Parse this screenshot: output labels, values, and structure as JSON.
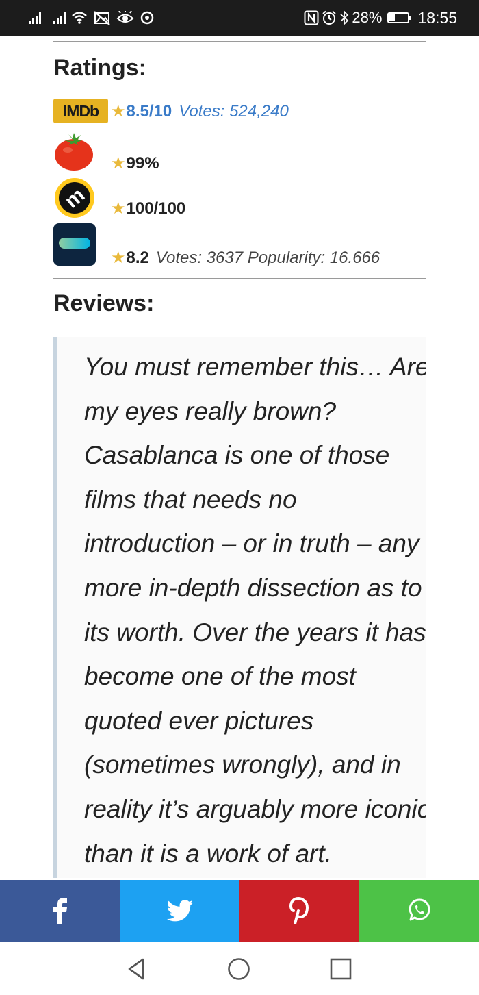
{
  "status_bar": {
    "signal_1_label": "",
    "signal_2_label": "",
    "battery": "28%",
    "battery_level": 0.28,
    "time": "18:55",
    "icons": [
      "signal-icon",
      "signal-icon",
      "wifi-icon",
      "no-image-icon",
      "eye-icon",
      "sync-icon",
      "nfc-icon",
      "alarm-icon",
      "bluetooth-icon",
      "battery-icon"
    ]
  },
  "ratings": {
    "heading": "Ratings:",
    "items": [
      {
        "source": "IMDb",
        "logo_text": "IMDb",
        "icon": "imdb-logo",
        "score": "8.5/10",
        "extra": "Votes: 524,240",
        "accent": "#3a7bc8"
      },
      {
        "source": "Rotten Tomatoes",
        "icon": "tomato-icon",
        "score": "99%",
        "extra": ""
      },
      {
        "source": "Metacritic",
        "icon": "metacritic-icon",
        "score": "100/100",
        "extra": ""
      },
      {
        "source": "TMDb",
        "icon": "tmdb-icon",
        "score": "8.2",
        "extra": "Votes: 3637 Popularity: 16.666"
      }
    ]
  },
  "reviews": {
    "heading": "Reviews:",
    "text": "You must remember this… Are my eyes really brown? Casablanca is one of those films that needs no introduction – or in truth – any more in-depth dissection as to its worth. Over the years it has become one of the most quoted ever pictures (sometimes wrongly), and in reality it’s arguably more iconic than it is a work of art. Although a"
  },
  "share_bar": [
    {
      "name": "facebook",
      "icon": "facebook-icon",
      "color": "#3b5998"
    },
    {
      "name": "twitter",
      "icon": "twitter-icon",
      "color": "#1da1f2"
    },
    {
      "name": "pinterest",
      "icon": "pinterest-icon",
      "color": "#cb2027"
    },
    {
      "name": "whatsapp",
      "icon": "whatsapp-icon",
      "color": "#4dc247"
    }
  ],
  "nav_bar": [
    "back-icon",
    "home-icon",
    "recents-icon"
  ]
}
